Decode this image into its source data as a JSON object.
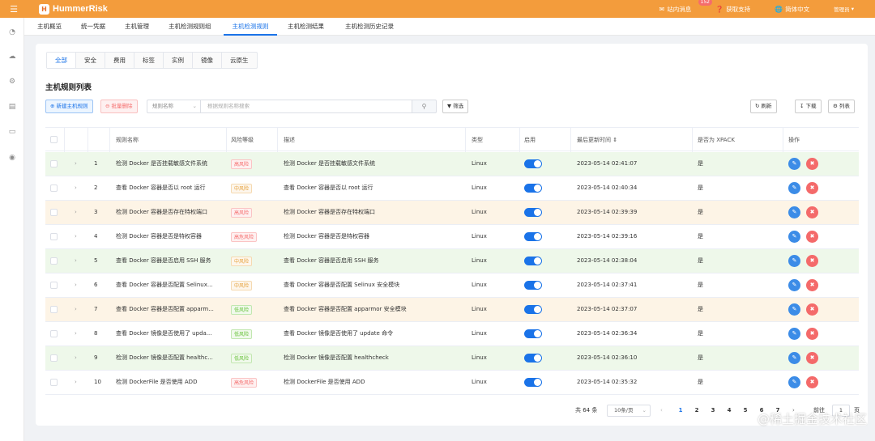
{
  "app": {
    "logo_text": "HummerRisk",
    "logo_mark": "H"
  },
  "topbar": {
    "messages_label": "站内消息",
    "messages_count": "152",
    "support_label": "获取支持",
    "language_label": "简体中文",
    "user_label": "管理员"
  },
  "nav_tabs": [
    "主机概览",
    "统一凭据",
    "主机管理",
    "主机检测规则组",
    "主机检测规则",
    "主机检测结果",
    "主机检测历史记录"
  ],
  "nav_active": "主机检测规则",
  "sub_tabs": [
    "全部",
    "安全",
    "费用",
    "标签",
    "实例",
    "镜像",
    "云原生"
  ],
  "sub_active": "全部",
  "card_title": "主机规则列表",
  "toolbar": {
    "create_label": "新建主机规则",
    "batch_delete_label": "批量删除",
    "search_field_label": "规则名称",
    "search_placeholder": "根据规则名称搜索",
    "filter_label": "筛选",
    "refresh_label": "刷新",
    "download_label": "下载",
    "columns_label": "列表"
  },
  "table": {
    "headers": {
      "name": "规则名称",
      "severity": "风险等级",
      "description": "描述",
      "type": "类型",
      "enabled": "启用",
      "updated": "最后更新时间",
      "xpack": "是否为 XPACK",
      "actions": "操作"
    },
    "rows": [
      {
        "index": "1",
        "name": "检测 Docker 是否挂载敏感文件系统",
        "severity": "高风险",
        "level": "high",
        "description": "检测 Docker 是否挂载敏感文件系统",
        "type": "Linux",
        "enabled": true,
        "updated": "2023-05-14 02:41:07",
        "xpack": "是",
        "tint": "#eef8ea"
      },
      {
        "index": "2",
        "name": "查看 Docker 容器是否以 root 运行",
        "severity": "中风险",
        "level": "mid",
        "description": "查看 Docker 容器是否以 root 运行",
        "type": "Linux",
        "enabled": true,
        "updated": "2023-05-14 02:40:34",
        "xpack": "是",
        "tint": "#ffffff"
      },
      {
        "index": "3",
        "name": "检测 Docker 容器是否存在特权端口",
        "severity": "高风险",
        "level": "high",
        "description": "检测 Docker 容器是否存在特权端口",
        "type": "Linux",
        "enabled": true,
        "updated": "2023-05-14 02:39:39",
        "xpack": "是",
        "tint": "#fdf4e6"
      },
      {
        "index": "4",
        "name": "检测 Docker 容器是否是特权容器",
        "severity": "高危风险",
        "level": "high",
        "description": "检测 Docker 容器是否是特权容器",
        "type": "Linux",
        "enabled": true,
        "updated": "2023-05-14 02:39:16",
        "xpack": "是",
        "tint": "#ffffff"
      },
      {
        "index": "5",
        "name": "查看 Docker 容器是否启用 SSH 服务",
        "severity": "中风险",
        "level": "mid",
        "description": "查看 Docker 容器是否启用 SSH 服务",
        "type": "Linux",
        "enabled": true,
        "updated": "2023-05-14 02:38:04",
        "xpack": "是",
        "tint": "#eef8ea"
      },
      {
        "index": "6",
        "name": "查看 Docker 容器是否配置 Selinux...",
        "severity": "中风险",
        "level": "mid",
        "description": "查看 Docker 容器是否配置 Selinux 安全模块",
        "type": "Linux",
        "enabled": true,
        "updated": "2023-05-14 02:37:41",
        "xpack": "是",
        "tint": "#ffffff"
      },
      {
        "index": "7",
        "name": "查看 Docker 容器是否配置 apparm...",
        "severity": "低风险",
        "level": "low",
        "description": "查看 Docker 容器是否配置 apparmor 安全模块",
        "type": "Linux",
        "enabled": true,
        "updated": "2023-05-14 02:37:07",
        "xpack": "是",
        "tint": "#fdf4e6"
      },
      {
        "index": "8",
        "name": "查看 Docker 镜像是否使用了 upda...",
        "severity": "低风险",
        "level": "low",
        "description": "查看 Docker 镜像是否使用了 update 命令",
        "type": "Linux",
        "enabled": true,
        "updated": "2023-05-14 02:36:34",
        "xpack": "是",
        "tint": "#ffffff"
      },
      {
        "index": "9",
        "name": "检测 Docker 镜像是否配置 healthc...",
        "severity": "低风险",
        "level": "low",
        "description": "检测 Docker 镜像是否配置 healthcheck",
        "type": "Linux",
        "enabled": true,
        "updated": "2023-05-14 02:36:10",
        "xpack": "是",
        "tint": "#eef8ea"
      },
      {
        "index": "10",
        "name": "检测 DockerFile 是否使用 ADD",
        "severity": "高危风险",
        "level": "high",
        "description": "检测 DockerFile 是否使用 ADD",
        "type": "Linux",
        "enabled": true,
        "updated": "2023-05-14 02:35:32",
        "xpack": "是",
        "tint": "#ffffff"
      }
    ]
  },
  "pagination": {
    "total": "共 64 条",
    "page_size": "10条/页",
    "pages": [
      "1",
      "2",
      "3",
      "4",
      "5",
      "6",
      "7"
    ],
    "current": "1",
    "goto_label": "前往",
    "goto_value": "1",
    "page_suffix": "页"
  },
  "watermark": "@稀土掘金技术社区"
}
